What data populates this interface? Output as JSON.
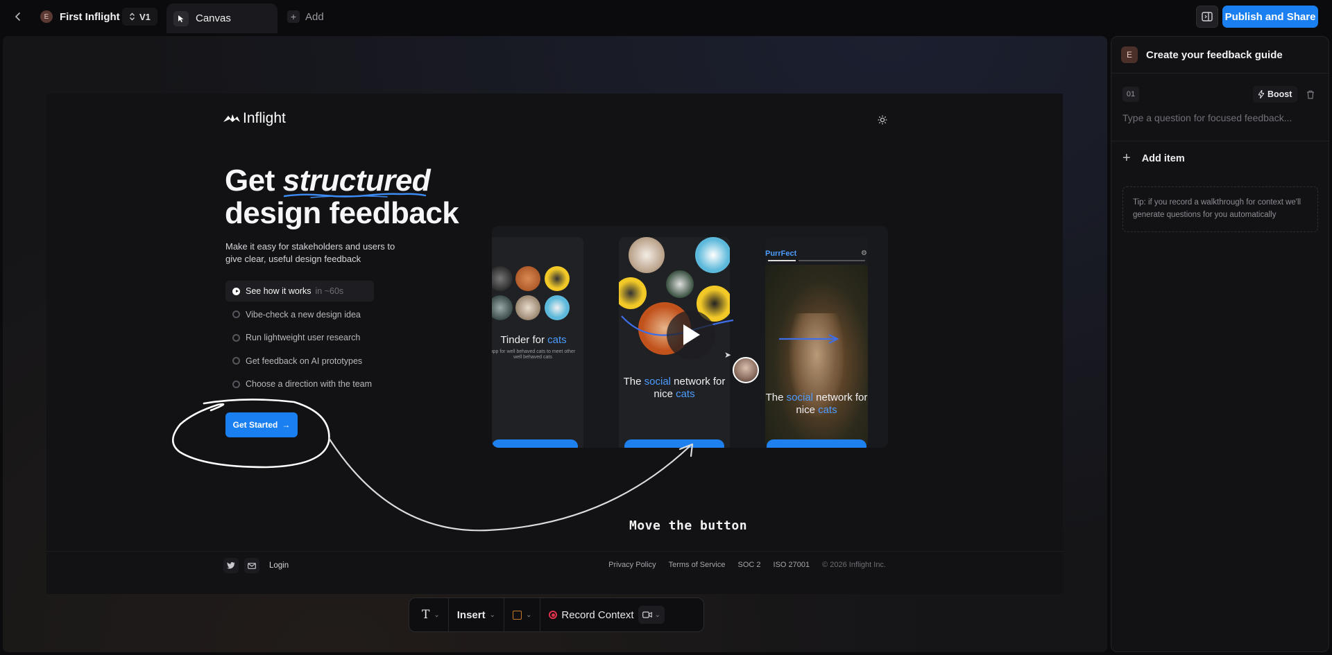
{
  "topbar": {
    "project_initial": "E",
    "project_name": "First Inflight",
    "version": "V1",
    "active_tab": "Canvas",
    "add_label": "Add",
    "publish_label": "Publish and Share"
  },
  "landing": {
    "logo_text": "Inflight",
    "hero_word1": "Get",
    "hero_italic": "structured",
    "hero_line2": "design feedback",
    "subtitle": "Make it easy for stakeholders and users to give clear, useful design feedback",
    "how_items": [
      {
        "label": "See how it works",
        "duration": "in ~60s"
      },
      {
        "label": "Vibe-check a new design idea"
      },
      {
        "label": "Run lightweight user research"
      },
      {
        "label": "Get feedback on AI prototypes"
      },
      {
        "label": "Choose a direction with the team"
      }
    ],
    "cta_label": "Get Started",
    "showcase": {
      "phone1_title_a": "Tinder for ",
      "phone1_title_b": "cats",
      "phone1_sub": "app for well behaved cats to meet other well behaved cats",
      "phone2_title_a": "The ",
      "phone2_title_b": "social",
      "phone2_title_c": " network for nice ",
      "phone2_title_d": "cats",
      "phone3_brand": "PurrFect",
      "phone3_title_a": "The ",
      "phone3_title_b": "social",
      "phone3_title_c": " network for nice ",
      "phone3_title_d": "cats"
    },
    "footer": {
      "login": "Login",
      "links": [
        "Privacy Policy",
        "Terms of Service",
        "SOC 2",
        "ISO 27001"
      ],
      "copyright": "© 2026 Inflight Inc."
    }
  },
  "annotation": {
    "note": "Move the button"
  },
  "toolbar": {
    "text_tool": "T",
    "insert_label": "Insert",
    "record_label": "Record Context"
  },
  "panel": {
    "initial": "E",
    "title": "Create your feedback guide",
    "question_number": "01",
    "boost_label": "Boost",
    "question_placeholder": "Type a question for focused feedback...",
    "add_item_label": "Add item",
    "tip": "Tip: if you record a walkthrough for context we'll generate questions for you automatically"
  },
  "colors": {
    "accent": "#1a7ff0",
    "link_blue": "#4d9cff",
    "record_red": "#e0334c"
  }
}
